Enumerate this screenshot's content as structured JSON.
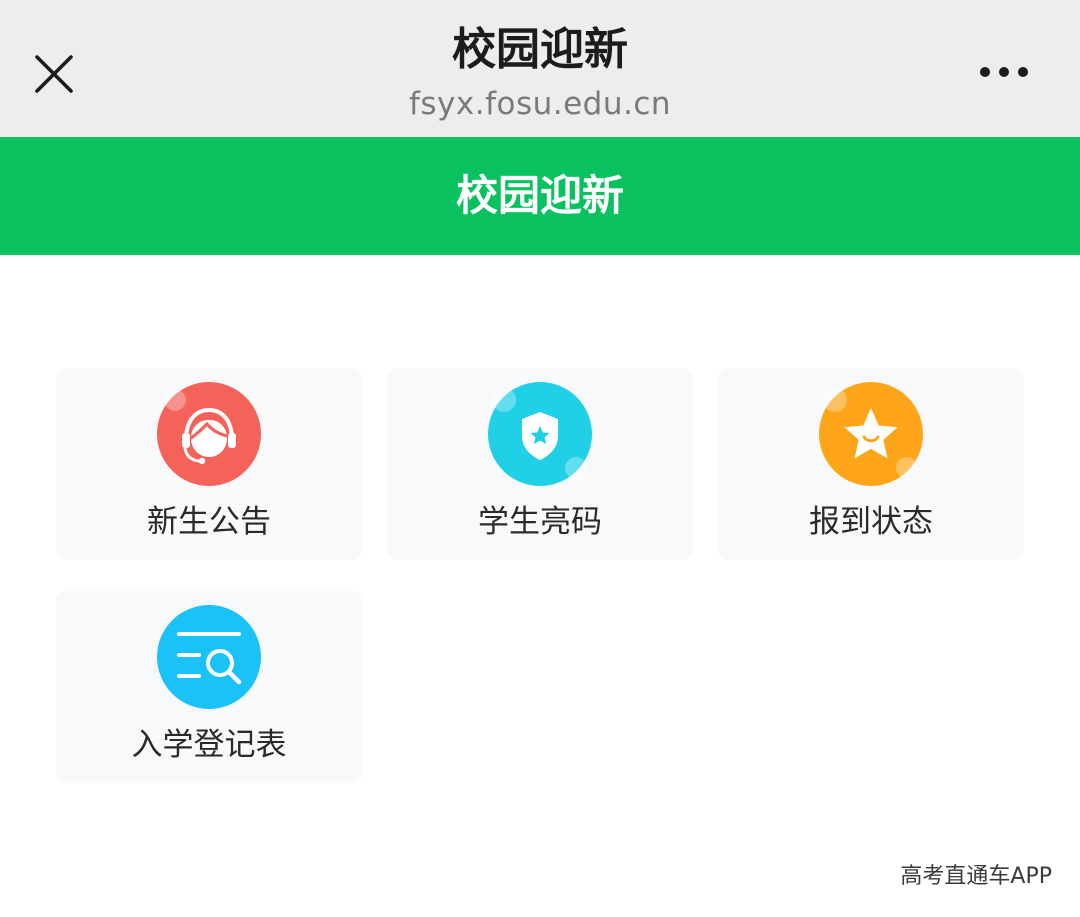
{
  "header": {
    "title": "校园迎新",
    "url": "fsyx.fosu.edu.cn",
    "close_icon": "close-icon",
    "more_icon": "more-icon"
  },
  "banner": {
    "title": "校园迎新",
    "color": "#0ac160"
  },
  "menu": {
    "items": [
      {
        "label": "新生公告",
        "icon": "headset-service-icon",
        "color": "#f4625a"
      },
      {
        "label": "学生亮码",
        "icon": "shield-star-icon",
        "color": "#1fd0e6"
      },
      {
        "label": "报到状态",
        "icon": "star-icon",
        "color": "#ffa51a"
      },
      {
        "label": "入学登记表",
        "icon": "list-search-icon",
        "color": "#1ac2f7"
      }
    ]
  },
  "watermark": "高考直通车APP"
}
